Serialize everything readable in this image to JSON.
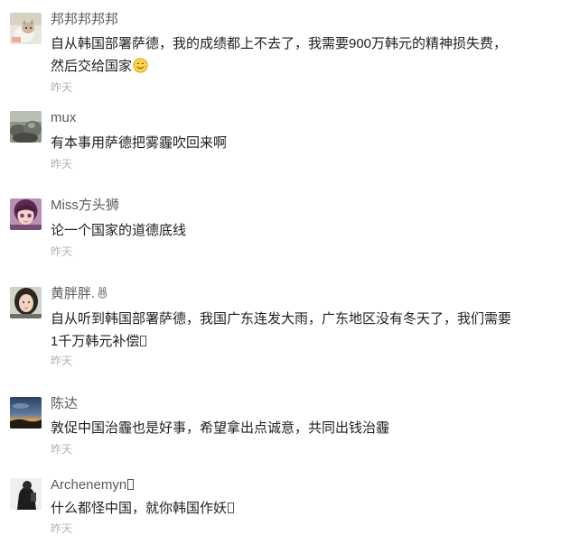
{
  "comments": [
    {
      "user": "邦邦邦邦邦",
      "text_line1": "自从韩国部署萨德，我的成绩都上不去了，我需要900万韩元的精神损失费，",
      "text_line2": "然后交给国家",
      "time": "昨天",
      "avatar_icon": "cat-avatar-icon",
      "trailing_icon": "smile-emoji-icon"
    },
    {
      "user": "mux",
      "text": "有本事用萨德把雾霾吹回来啊",
      "time": "昨天",
      "avatar_icon": "rocks-avatar-icon"
    },
    {
      "user": "Miss方头狮",
      "text": "论一个国家的道德底线",
      "time": "昨天",
      "avatar_icon": "girl-avatar-icon"
    },
    {
      "user": "黄胖胖.",
      "user_badge": "rabbit-badge-icon",
      "text_line1": "自从听到韩国部署萨德，我国广东连发大雨，广东地区没有冬天了，我们需要",
      "text_line2": "1千万韩元补偿",
      "time": "昨天",
      "avatar_icon": "woman-avatar-icon",
      "trailing_icon": "missing-glyph-icon"
    },
    {
      "user": "陈达",
      "text": "敦促中国治霾也是好事，希望拿出点诚意，共同出钱治霾",
      "time": "昨天",
      "avatar_icon": "sunset-avatar-icon"
    },
    {
      "user": "Archenemyn",
      "user_trailing_icon": "missing-glyph-icon",
      "text": "什么都怪中国，就你韩国作妖",
      "time": "昨天",
      "avatar_icon": "figure-avatar-icon",
      "trailing_icon": "missing-glyph-icon"
    }
  ],
  "colors": {
    "username": "#5a5a5a",
    "text": "#1f1f1f",
    "timestamp": "#b3b3b3"
  }
}
